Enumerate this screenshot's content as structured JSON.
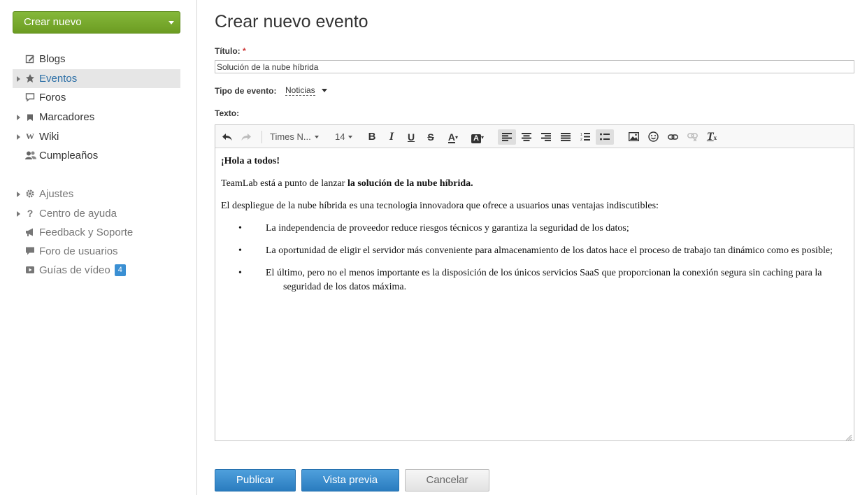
{
  "sidebar": {
    "create_button": "Crear nuevo",
    "items": [
      {
        "label": "Blogs",
        "icon": "edit-icon"
      },
      {
        "label": "Eventos",
        "icon": "pin-icon"
      },
      {
        "label": "Foros",
        "icon": "comment-icon"
      },
      {
        "label": "Marcadores",
        "icon": "bookmark-icon"
      },
      {
        "label": "Wiki",
        "icon": "wiki-icon"
      },
      {
        "label": "Cumpleaños",
        "icon": "people-icon"
      },
      {
        "label": "Ajustes",
        "icon": "gear-icon"
      },
      {
        "label": "Centro de ayuda",
        "icon": "question-icon"
      },
      {
        "label": "Feedback y Soporte",
        "icon": "megaphone-icon"
      },
      {
        "label": "Foro de usuarios",
        "icon": "chat-bubble-icon"
      },
      {
        "label": "Guías de vídeo",
        "icon": "video-icon",
        "badge": "4"
      }
    ],
    "active_index": 1
  },
  "main": {
    "title": "Crear nuevo evento",
    "title_field": {
      "label": "Título:",
      "required_mark": "*",
      "value": "Solución de la nube híbrida"
    },
    "event_type": {
      "label": "Tipo de evento:",
      "value": "Noticias"
    },
    "text_label": "Texto:"
  },
  "editor": {
    "font_family": "Times N...",
    "font_size": "14",
    "toolbar_icons": [
      "undo-icon",
      "redo-icon",
      "bold-icon",
      "italic-icon",
      "underline-icon",
      "strikethrough-icon",
      "text-color-icon",
      "background-color-icon",
      "align-left-icon",
      "align-center-icon",
      "align-right-icon",
      "align-justify-icon",
      "numbered-list-icon",
      "bulleted-list-icon",
      "image-icon",
      "smiley-icon",
      "link-icon",
      "unlink-icon",
      "remove-format-icon"
    ],
    "content": {
      "greeting": "¡Hola a todos!",
      "intro_prefix": "TeamLab está a punto de lanzar ",
      "intro_bold": "la solución de la nube híbrida.",
      "paragraph": "El despliegue de la nube híbrida es una tecnologia innovadora que ofrece a usuarios unas ventajas indiscutibles:",
      "bullet": "•",
      "bullets": [
        "La independencia de proveedor reduce riesgos técnicos y garantiza la seguridad de los datos;",
        "La oportunidad de eligir el servidor más conveniente para almacenamiento de los datos hace el proceso de trabajo tan dinámico como es posible;",
        "El último, pero no el menos importante es la disposición de los únicos servicios SaaS que proporcionan la conexión segura sin caching para la seguridad de los datos máxima."
      ]
    }
  },
  "actions": {
    "publish": "Publicar",
    "preview": "Vista previa",
    "cancel": "Cancelar"
  },
  "colors": {
    "create_button": "#77aa2c",
    "primary_button": "#2f84c7",
    "active_nav_text": "#2a6ea6",
    "badge": "#3a8fd3",
    "required": "#cc3333"
  }
}
